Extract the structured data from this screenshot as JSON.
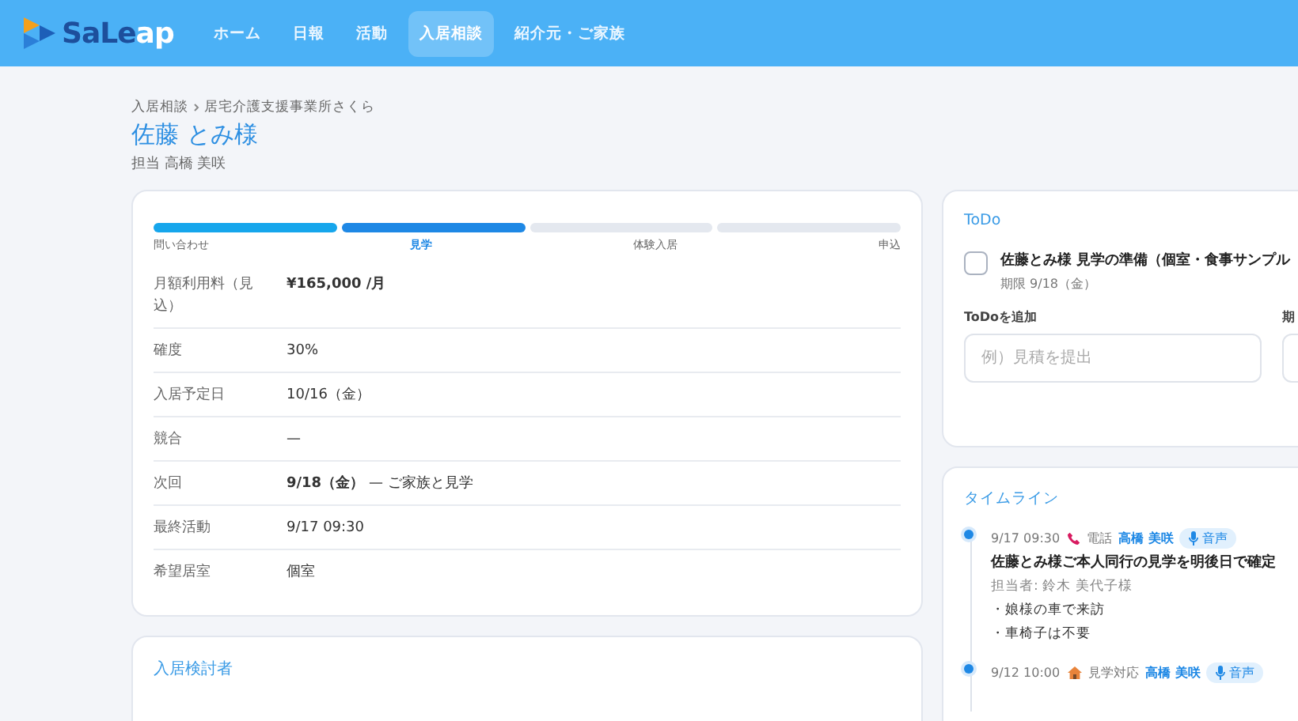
{
  "header": {
    "logo": [
      "SaLe",
      "ap"
    ],
    "nav": [
      {
        "label": "ホーム",
        "selected": false
      },
      {
        "label": "日報",
        "selected": false
      },
      {
        "label": "活動",
        "selected": false
      },
      {
        "label": "入居相談",
        "selected": true
      },
      {
        "label": "紹介元・ご家族",
        "selected": false
      }
    ]
  },
  "breadcrumb": [
    "入居相談",
    "居宅介護支援事業所さくら"
  ],
  "title": "佐藤 とみ様",
  "assignee": "担当 高橋 美咲",
  "stages": [
    {
      "label": "問い合わせ",
      "selected": false
    },
    {
      "label": "見学",
      "selected": true
    },
    {
      "label": "体験入居",
      "selected": false
    },
    {
      "label": "申込",
      "selected": false
    }
  ],
  "details": [
    {
      "label": "月額利用料（見込）",
      "value": "¥165,000 /月",
      "emphasis": true
    },
    {
      "label": "確度",
      "value": "30%",
      "emphasis": false
    },
    {
      "label": "入居予定日",
      "value": "10/16（金）",
      "emphasis": false
    },
    {
      "label": "競合",
      "value": "—",
      "emphasis": false
    },
    {
      "label": "次回",
      "value": "**9/18（金）** — ご家族と見学",
      "emphasis": false
    },
    {
      "label": "最終活動",
      "value": "9/17 09:30",
      "emphasis": false
    },
    {
      "label": "希望居室",
      "value": "個室",
      "emphasis": false
    }
  ],
  "candidates": {
    "title": "入居検討者"
  },
  "todo": {
    "title": "ToDo",
    "items": [
      {
        "text": "佐藤とみ様 見学の準備（個室・食事サンプル",
        "due": "期限 9/18（金）",
        "checked": false
      }
    ],
    "fields": [
      {
        "label": "ToDoを追加",
        "placeholder": "例）見積を提出"
      },
      {
        "label": "期"
      }
    ]
  },
  "timeline": {
    "title": "タイムライン",
    "entries": [
      {
        "time": "9/17 09:30",
        "kind": "call",
        "type": "電話",
        "staff": "高橋 美咲",
        "badge": "音声",
        "title": "佐藤とみ様ご本人同行の見学を明後日で確定",
        "person": "担当者: 鈴木 美代子様",
        "notes": [
          "・娘様の車で来訪",
          "・車椅子は不要"
        ]
      },
      {
        "time": "9/12 10:00",
        "kind": "visit",
        "type": "見学対応",
        "staff": "高橋 美咲",
        "badge": "音声"
      }
    ]
  }
}
